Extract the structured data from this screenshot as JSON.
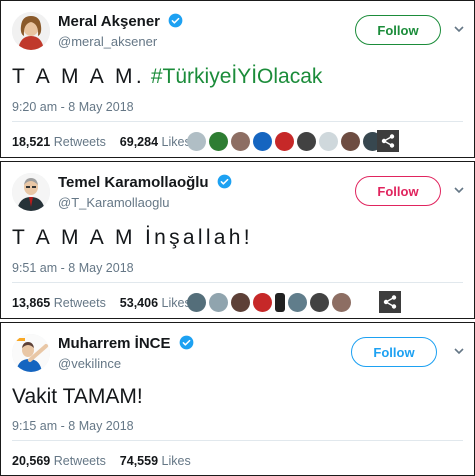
{
  "tweets": [
    {
      "name": "Meral Akşener",
      "handle": "@meral_aksener",
      "follow_label": "Follow",
      "follow_color": "#1b8c3a",
      "text_main": "T A M A M.",
      "text_hashtag": "#TürkiyeİYİOlacak",
      "timestamp": "9:20 am - 8 May 2018",
      "retweets": "18,521",
      "retweets_label": "Retweets",
      "likes": "69,284",
      "likes_label": "Likes"
    },
    {
      "name": "Temel Karamollaoğlu",
      "handle": "@T_Karamollaoglu",
      "follow_label": "Follow",
      "follow_color": "#e0245e",
      "text_main": "T A M A M İnşallah!",
      "timestamp": "9:51 am - 8 May 2018",
      "retweets": "13,865",
      "retweets_label": "Retweets",
      "likes": "53,406",
      "likes_label": "Likes"
    },
    {
      "name": "Muharrem İNCE",
      "handle": "@vekilince",
      "follow_label": "Follow",
      "follow_color": "#1da1f2",
      "text_main": "Vakit TAMAM!",
      "timestamp": "9:15 am - 8 May 2018",
      "retweets": "20,569",
      "retweets_label": "Retweets",
      "likes": "74,559",
      "likes_label": "Likes"
    }
  ],
  "icons": {
    "verified": "verified-badge-icon",
    "chevron": "chevron-down-icon",
    "share": "share-icon"
  },
  "colors": {
    "verified_blue": "#1da1f2",
    "text_gray": "#657786",
    "divider": "#e1e8ed"
  }
}
